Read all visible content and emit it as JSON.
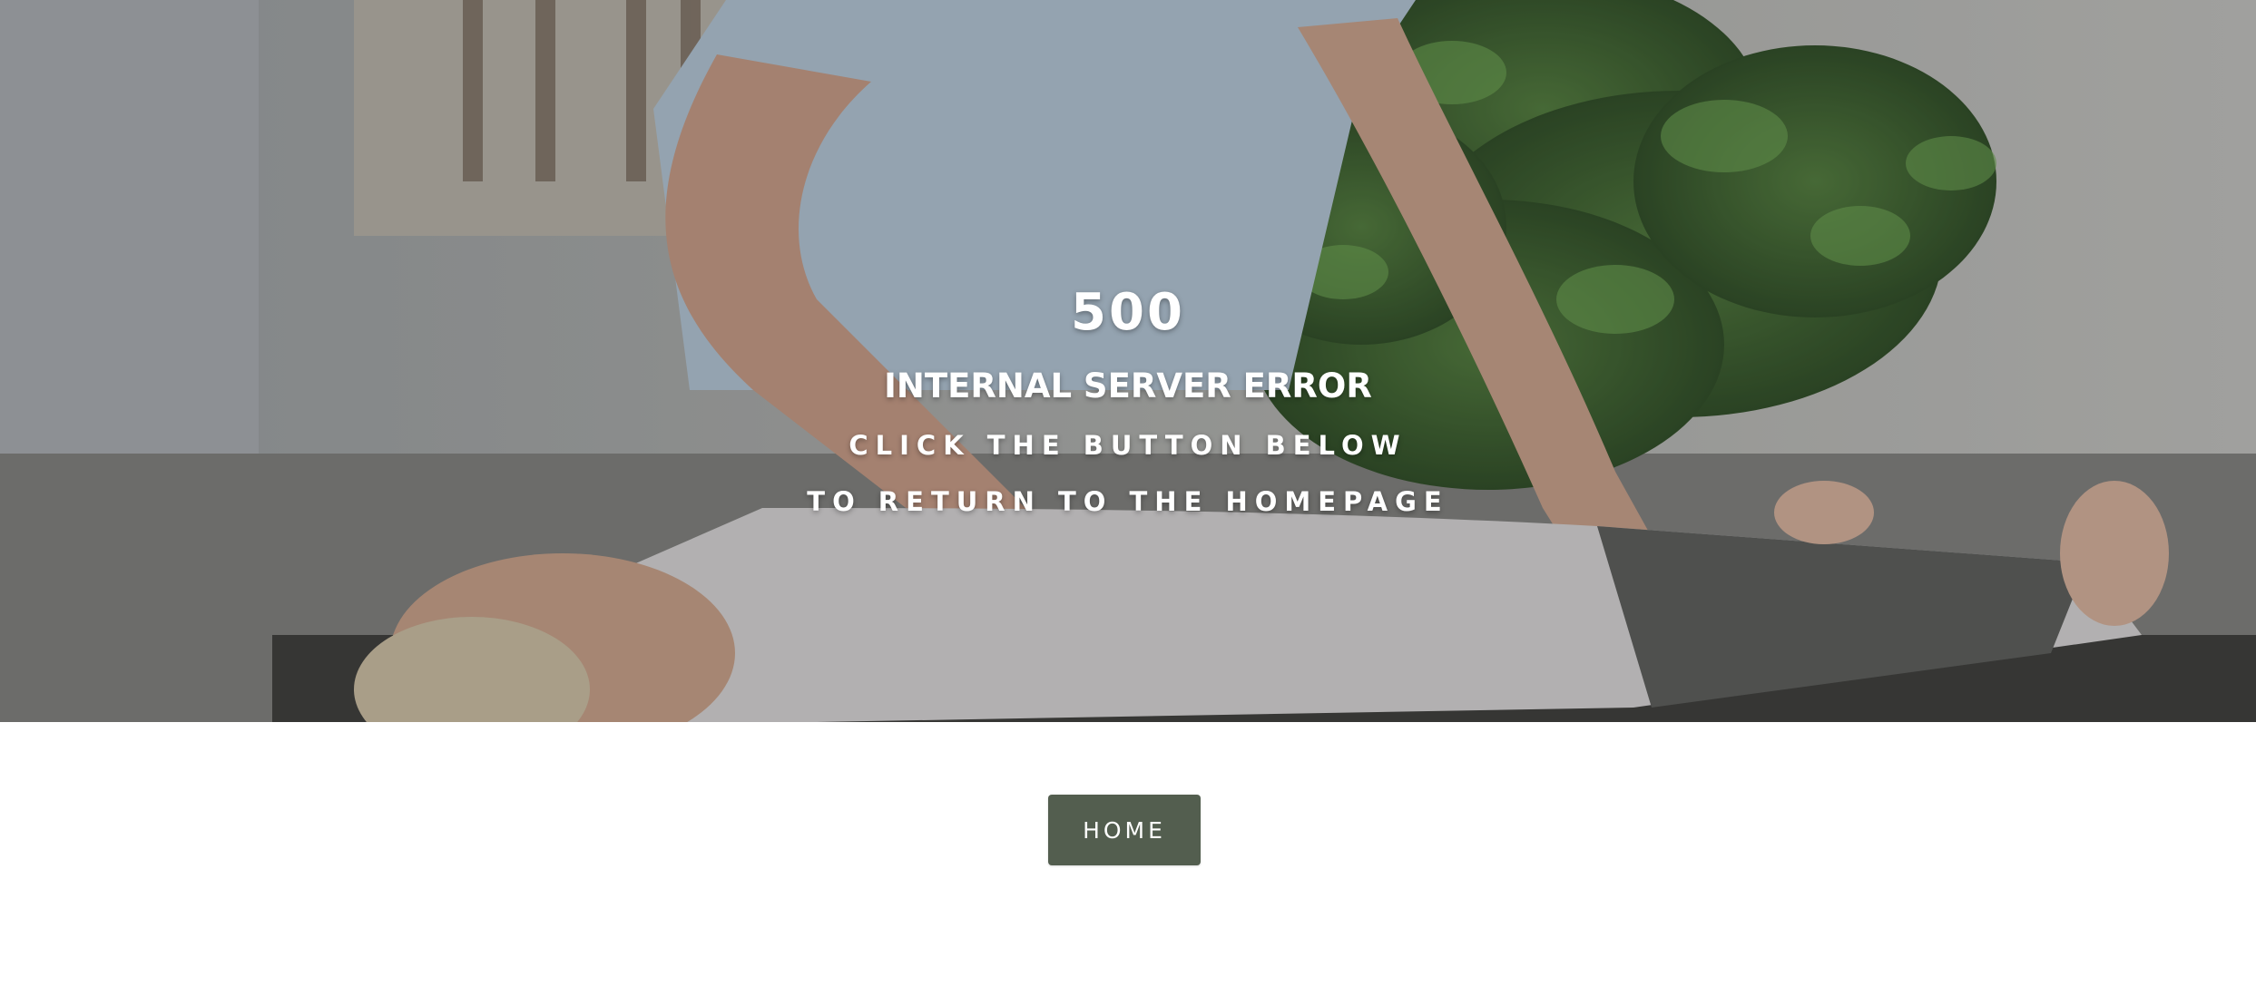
{
  "hero": {
    "code": "500",
    "title": "INTERNAL SERVER ERROR",
    "line1": "CLICK THE BUTTON BELOW",
    "line2": "TO RETURN TO THE HOMEPAGE"
  },
  "home_button": {
    "label": "HOME"
  },
  "colors": {
    "button_bg": "#535e4f",
    "text": "#ffffff",
    "page_bg": "#ffffff"
  }
}
